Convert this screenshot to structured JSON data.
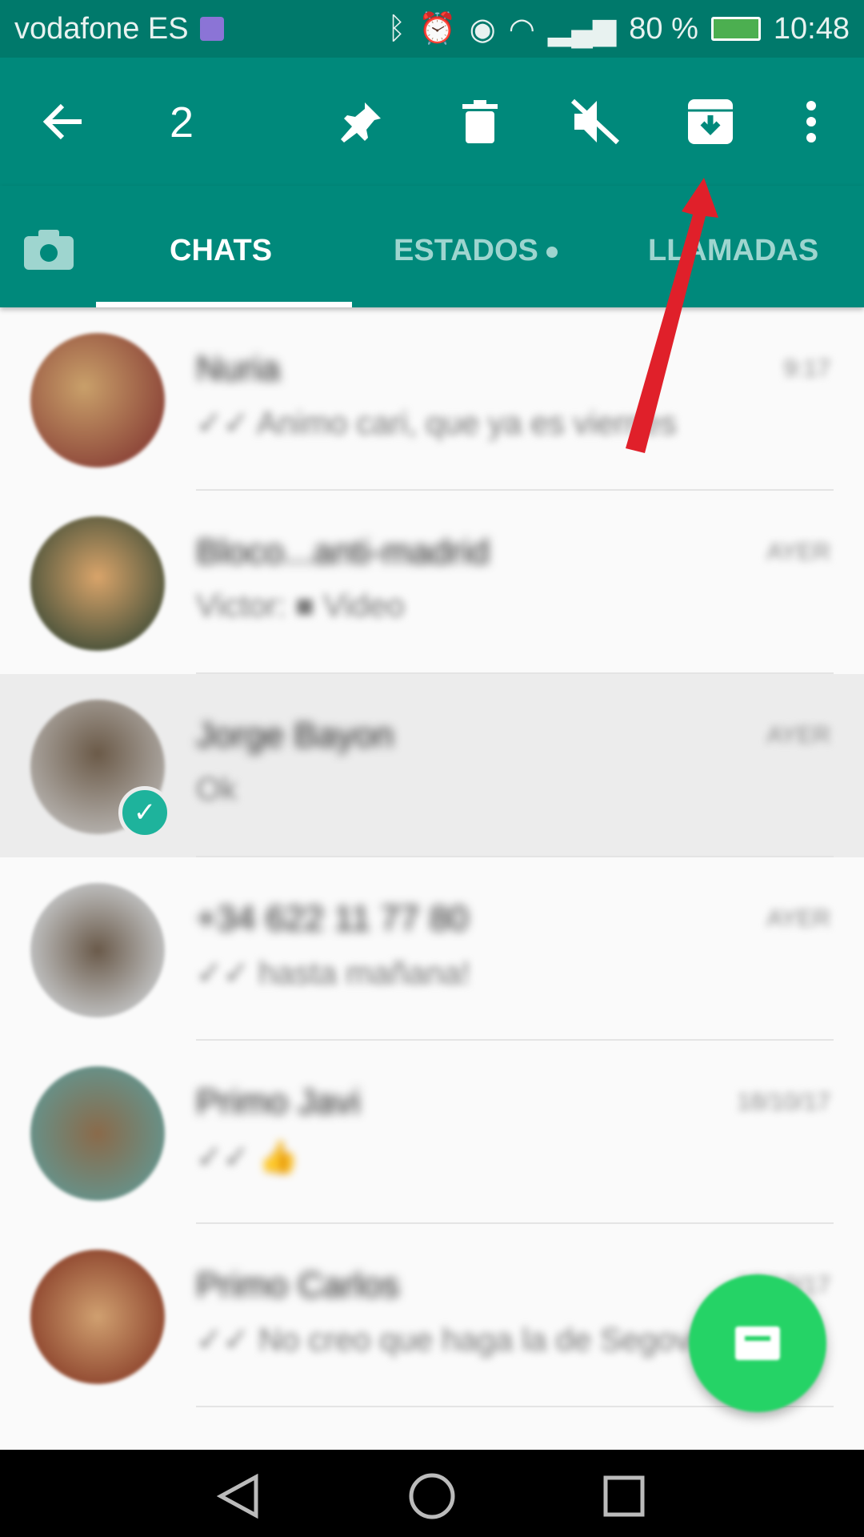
{
  "status_bar": {
    "carrier": "vodafone ES",
    "battery": "80 %",
    "time": "10:48",
    "icons": [
      "gallery-icon",
      "bluetooth-icon",
      "alarm-icon",
      "eye-icon",
      "wifi-icon",
      "signal-icon",
      "battery-charging-icon"
    ]
  },
  "toolbar": {
    "selected_count": "2",
    "actions": [
      "back-icon",
      "pin-icon",
      "delete-icon",
      "mute-icon",
      "archive-icon",
      "more-icon"
    ]
  },
  "tabs": [
    {
      "label": "CHATS",
      "active": true
    },
    {
      "label": "ESTADOS",
      "dot": true
    },
    {
      "label": "LLAMADAS"
    }
  ],
  "chats": [
    {
      "name": "Nuria",
      "time": "9:17",
      "message": "✓✓ Animo cari, que ya es viernes",
      "selected": false
    },
    {
      "name": "Bloco...anti-madrid",
      "time": "AYER",
      "message": "Victor: ■ Video",
      "selected": false
    },
    {
      "name": "Jorge Bayon",
      "time": "AYER",
      "message": "Ok",
      "selected": true
    },
    {
      "name": "+34 622 11 77 80",
      "time": "AYER",
      "message": "✓✓ hasta mañana!",
      "selected": false
    },
    {
      "name": "Primo Javi",
      "time": "18/10/17",
      "message": "✓✓ 👍",
      "selected": false
    },
    {
      "name": "Primo Carlos",
      "time": "17/10/17",
      "message": "✓✓ No creo que haga la de Segovia",
      "selected": false
    }
  ],
  "colors": {
    "primary": "#00897b",
    "status": "#00796b",
    "fab": "#25d366",
    "annotation_arrow": "#e0202a"
  }
}
